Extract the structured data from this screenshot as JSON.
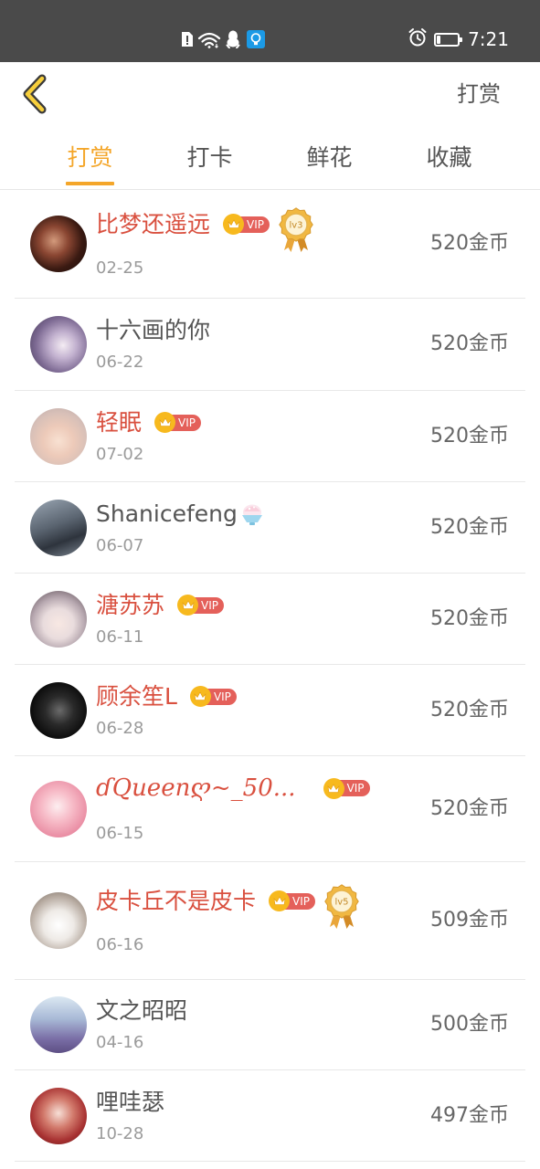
{
  "colors": {
    "accent": "#f4a62a",
    "vip_name": "#d9503f",
    "regular_name": "#555555",
    "status_bar_bg": "#4a4a4a",
    "vip_badge": "#e4605a",
    "crown": "#f7b91e"
  },
  "status_bar": {
    "time": "7:21",
    "battery_level": 0.2,
    "left_icons": [
      "sim-alert-icon",
      "wifi-icon",
      "qq-icon",
      "app-notification-icon"
    ],
    "right_icons": [
      "alarm-icon",
      "battery-icon"
    ]
  },
  "header": {
    "back_icon": "chevron-left-icon",
    "title": "打赏"
  },
  "tabs": [
    {
      "label": "打赏",
      "selected": true
    },
    {
      "label": "打卡",
      "selected": false
    },
    {
      "label": "鲜花",
      "selected": false
    },
    {
      "label": "收藏",
      "selected": false
    }
  ],
  "badges": {
    "vip_icon": "crown-icon",
    "vip_label": "VIP",
    "medal_icon": "level-medal-icon"
  },
  "list": {
    "rows": [
      {
        "name": "比梦还遥远",
        "vip": true,
        "medal": "lv3",
        "date": "02-25",
        "amount": "520金币"
      },
      {
        "name": "十六画的你",
        "vip": false,
        "date": "06-22",
        "amount": "520金币"
      },
      {
        "name": "轻眠",
        "vip": true,
        "date": "07-02",
        "amount": "520金币"
      },
      {
        "name": "Shanicefeng",
        "name_icon": "shaved-ice-emoji-icon",
        "vip": false,
        "date": "06-07",
        "amount": "520金币"
      },
      {
        "name": "溏苏苏",
        "vip": true,
        "date": "06-11",
        "amount": "520金币"
      },
      {
        "name": "顾余笙L",
        "vip": true,
        "date": "06-28",
        "amount": "520金币"
      },
      {
        "name": "ɗQueenღ~_50...",
        "vip": true,
        "date": "06-15",
        "amount": "520金币"
      },
      {
        "name": "皮卡丘不是皮卡",
        "vip": true,
        "medal": "lv5",
        "date": "06-16",
        "amount": "509金币"
      },
      {
        "name": "文之昭昭",
        "vip": false,
        "date": "04-16",
        "amount": "500金币"
      },
      {
        "name": "哩哇瑟",
        "vip": false,
        "date": "10-28",
        "amount": "497金币"
      }
    ]
  }
}
